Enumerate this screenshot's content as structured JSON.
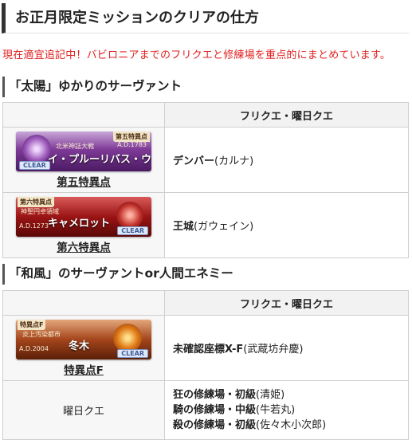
{
  "heading": "お正月限定ミッションのクリアの仕方",
  "notice": "現在適宜追記中！バビロニアまでのフリクエと修練場を重点的にまとめています。",
  "sections": [
    {
      "title": "「太陽」ゆかりのサーヴァント",
      "column_header": "フリクエ・曜日クエ",
      "rows": [
        {
          "banner": {
            "tag": "第五特異点",
            "date": "A.D.1783",
            "sub": "北米神話大戦",
            "main": "イ・プルーリバス・ウナム",
            "clear": "CLEAR"
          },
          "link": "第五特異点",
          "quest_bold": "デンバー",
          "quest_rest": "(カルナ)"
        },
        {
          "banner": {
            "tag": "第六特異点",
            "date": "A.D.1273",
            "sub": "神聖円卓領域",
            "main": "キャメロット",
            "clear": "CLEAR"
          },
          "link": "第六特異点",
          "quest_bold": "王城",
          "quest_rest": "(ガウェイン)"
        }
      ]
    },
    {
      "title": "「和風」のサーヴァントor人間エネミー",
      "column_header": "フリクエ・曜日クエ",
      "rows": [
        {
          "banner": {
            "tag": "特異点F",
            "date": "A.D.2004",
            "sub": "炎上汚染都市",
            "main": "冬木",
            "clear": "CLEAR"
          },
          "link": "特異点F",
          "quest_bold": "未確認座標X-F",
          "quest_rest": "(武蔵坊弁慶)"
        },
        {
          "left_text": "曜日クエ",
          "quests": [
            {
              "bold": "狂の修練場・初級",
              "rest": "(清姫)"
            },
            {
              "bold": "騎の修練場・中級",
              "rest": "(牛若丸)"
            },
            {
              "bold": "殺の修練場・初級",
              "rest": "(佐々木小次郎)"
            }
          ]
        }
      ]
    }
  ]
}
